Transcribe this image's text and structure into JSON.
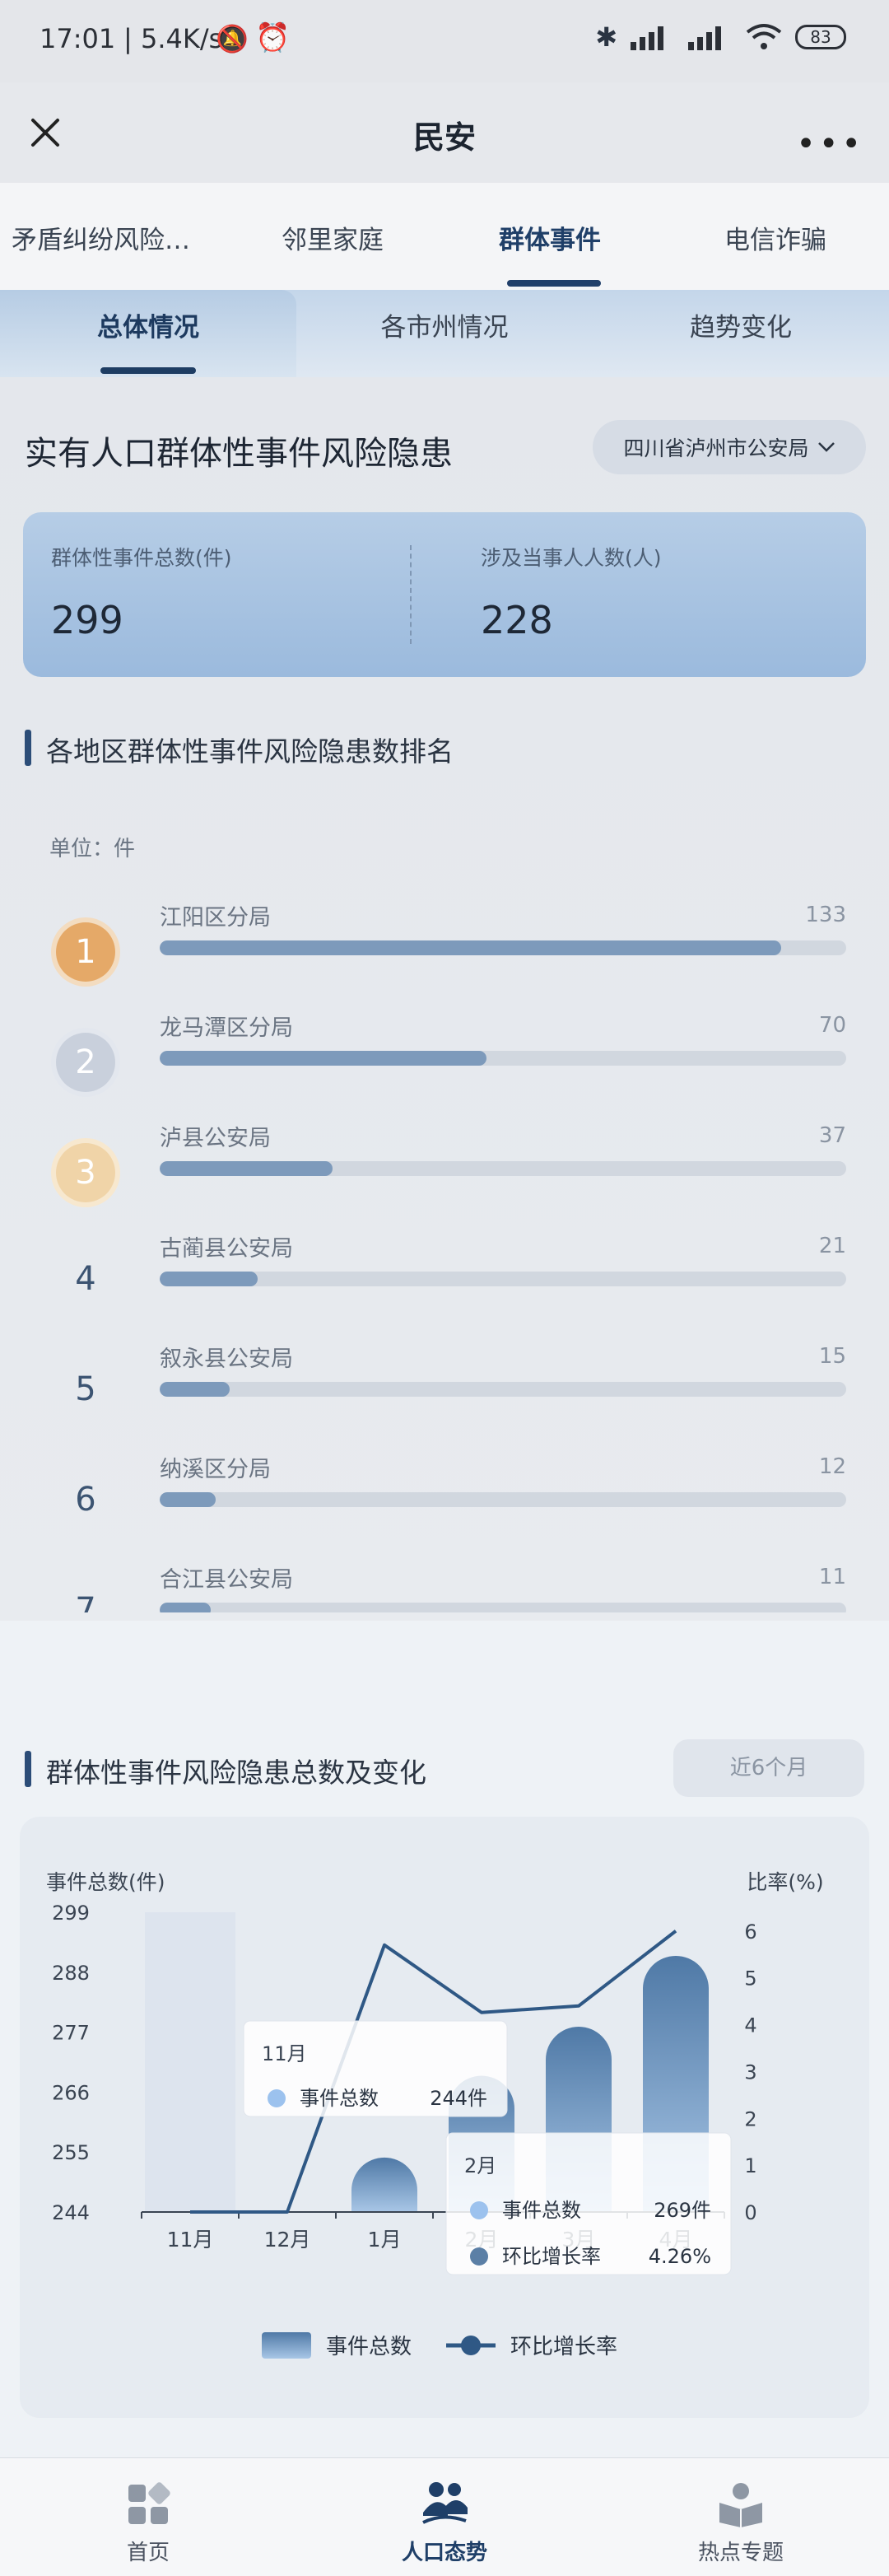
{
  "status_bar": {
    "time": "17:01",
    "speed": "| 5.4K/s",
    "battery": "83"
  },
  "header": {
    "title": "民安"
  },
  "top_tabs": [
    {
      "label": "矛盾纠纷风险…"
    },
    {
      "label": "邻里家庭"
    },
    {
      "label": "群体事件"
    },
    {
      "label": "电信诈骗"
    }
  ],
  "sub_tabs": [
    {
      "label": "总体情况"
    },
    {
      "label": "各市州情况"
    },
    {
      "label": "趋势变化"
    }
  ],
  "section_title": "实有人口群体性事件风险隐患",
  "region_select": "四川省泸州市公安局",
  "stats": [
    {
      "label": "群体性事件总数(件)",
      "value": "299"
    },
    {
      "label": "涉及当事人人数(人)",
      "value": "228"
    }
  ],
  "ranking": {
    "title": "各地区群体性事件风险隐患数排名",
    "unit": "单位：件",
    "max": 147,
    "items": [
      {
        "rank": "1",
        "name": "江阳区分局",
        "value": 133
      },
      {
        "rank": "2",
        "name": "龙马潭区分局",
        "value": 70
      },
      {
        "rank": "3",
        "name": "泸县公安局",
        "value": 37
      },
      {
        "rank": "4",
        "name": "古蔺县公安局",
        "value": 21
      },
      {
        "rank": "5",
        "name": "叙永县公安局",
        "value": 15
      },
      {
        "rank": "6",
        "name": "纳溪区分局",
        "value": 12
      },
      {
        "rank": "7",
        "name": "合江县公安局",
        "value": 11
      }
    ],
    "badge_colors": [
      "#e5a968",
      "#c9d0dc",
      "#f0d4a8"
    ]
  },
  "trend": {
    "title": "群体性事件风险隐患总数及变化",
    "period": "近6个月"
  },
  "chart_data": {
    "type": "bar",
    "categories": [
      "11月",
      "12月",
      "1月",
      "2月",
      "3月",
      "4月"
    ],
    "series": [
      {
        "name": "事件总数",
        "type": "bar",
        "axis": "left",
        "values": [
          244,
          244,
          254,
          269,
          278,
          291
        ]
      },
      {
        "name": "环比增长率",
        "type": "line",
        "axis": "right",
        "values": [
          0,
          0,
          5.7,
          4.26,
          4.4,
          6.0
        ]
      }
    ],
    "ylabel": "事件总数(件)",
    "y2label": "比率(%)",
    "yticks": [
      244,
      255,
      266,
      277,
      288,
      299
    ],
    "ylim": [
      244,
      299
    ],
    "y2ticks": [
      0,
      1,
      2,
      3,
      4,
      5,
      6
    ],
    "y2lim": [
      0,
      6.4
    ],
    "legend": [
      "事件总数",
      "环比增长率"
    ],
    "legend_position": "bottom",
    "highlighted_category": "11月",
    "tooltips": [
      {
        "title": "11月",
        "rows": [
          {
            "label": "事件总数",
            "value": "244件"
          }
        ]
      },
      {
        "title": "2月",
        "rows": [
          {
            "label": "事件总数",
            "value": "269件"
          },
          {
            "label": "环比增长率",
            "value": "4.26%"
          }
        ]
      }
    ]
  },
  "bottom_nav": [
    {
      "label": "首页",
      "icon": "grid-icon"
    },
    {
      "label": "人口态势",
      "icon": "people-icon"
    },
    {
      "label": "热点专题",
      "icon": "reader-icon"
    }
  ]
}
